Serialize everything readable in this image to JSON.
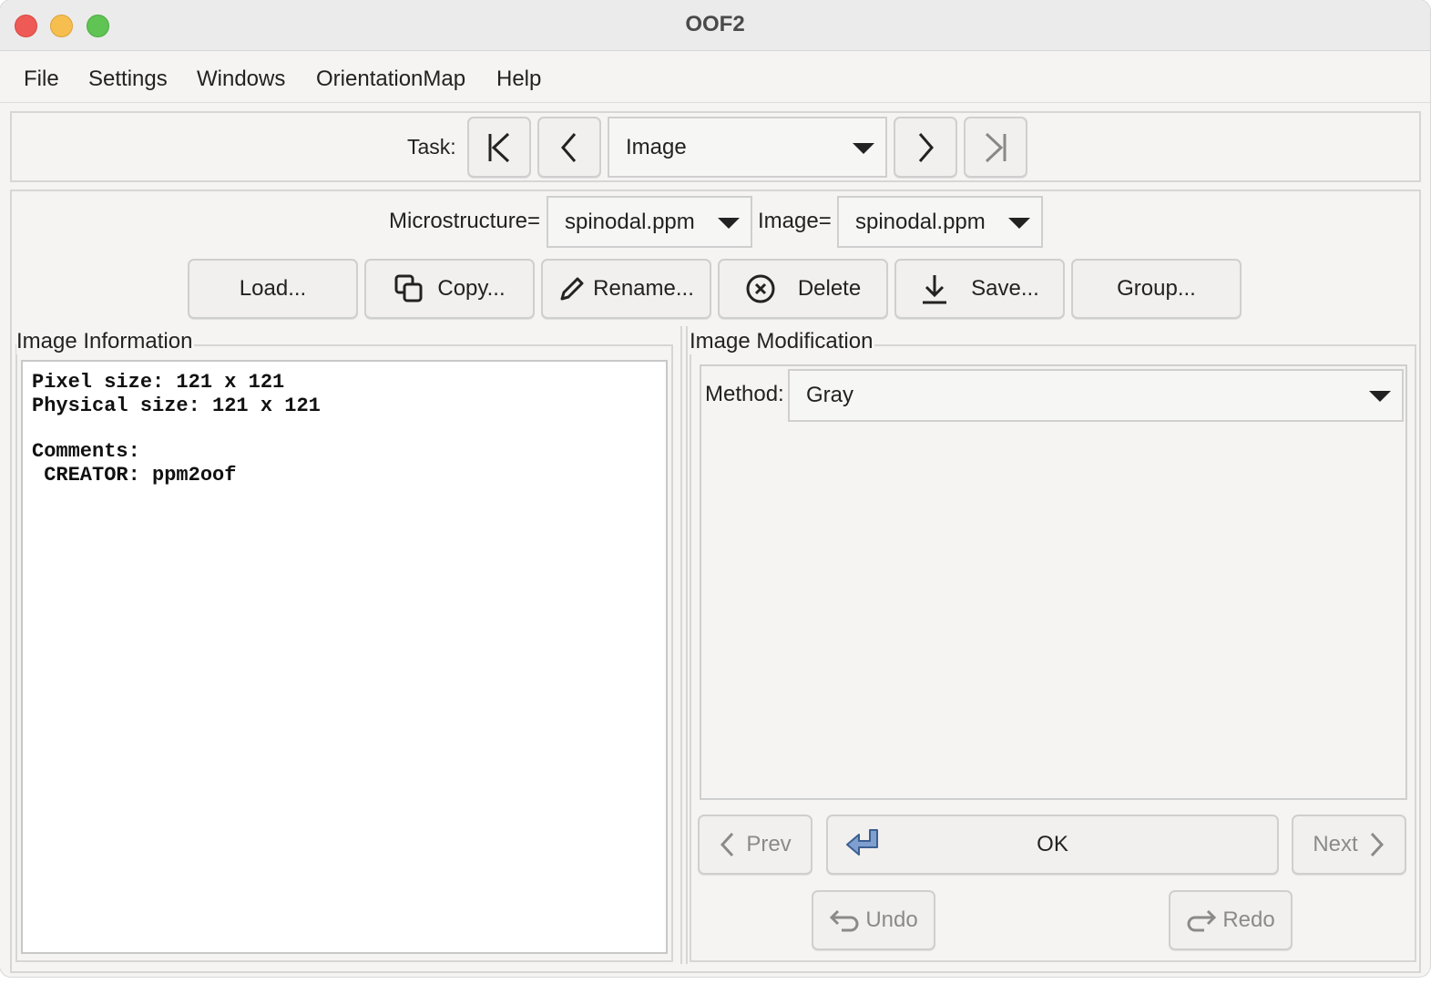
{
  "window": {
    "title": "OOF2"
  },
  "menubar": {
    "items": [
      "File",
      "Settings",
      "Windows",
      "OrientationMap",
      "Help"
    ]
  },
  "taskbar": {
    "label": "Task:",
    "current_task": "Image"
  },
  "selectors": {
    "microstructure_label": "Microstructure=",
    "microstructure_value": "spinodal.ppm",
    "image_label": "Image=",
    "image_value": "spinodal.ppm"
  },
  "actions": {
    "load": "Load...",
    "copy": "Copy...",
    "rename": "Rename...",
    "delete": "Delete",
    "save": "Save...",
    "group": "Group..."
  },
  "image_info": {
    "title": "Image Information",
    "pixel_size": "Pixel size: 121 x 121",
    "physical_size": "Physical size: 121 x 121",
    "comments_header": "Comments:",
    "comment_line": " CREATOR: ppm2oof"
  },
  "image_mod": {
    "title": "Image Modification",
    "method_label": "Method:",
    "method_value": "Gray",
    "prev": "Prev",
    "ok": "OK",
    "next": "Next",
    "undo": "Undo",
    "redo": "Redo"
  }
}
